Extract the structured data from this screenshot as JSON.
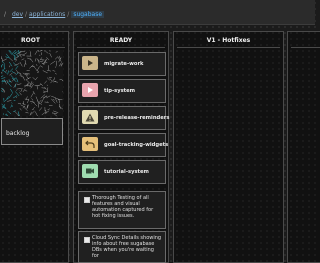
{
  "breadcrumb": {
    "root": "/",
    "items": [
      "dev",
      "applications"
    ],
    "current": "sugabase"
  },
  "columns": {
    "root": {
      "title": "ROOT",
      "backlog_label": "backlog"
    },
    "ready": {
      "title": "READY",
      "cards": [
        {
          "label": "migrate-work",
          "icon": "video-icon",
          "color": "#cbb58a"
        },
        {
          "label": "tip-system",
          "icon": "play-icon",
          "color": "#e8a4ad"
        },
        {
          "label": "pre-release-reminders",
          "icon": "warning-icon",
          "color": "#e0d9b0"
        },
        {
          "label": "goal-tracking-widgets",
          "icon": "undo-arrow-icon",
          "color": "#e6c07a"
        },
        {
          "label": "tutorial-system",
          "icon": "video-icon",
          "color": "#9fdcb0"
        }
      ],
      "tasks": [
        {
          "text": "Thorough Testing of all features and visual automation captured for hot fixing issues."
        },
        {
          "text": "Cloud Sync Details showing info about free sugabase DBs when you're waiting for"
        }
      ]
    },
    "v1": {
      "title": "V1 - Hotfixes"
    },
    "next": {
      "title": ""
    }
  }
}
